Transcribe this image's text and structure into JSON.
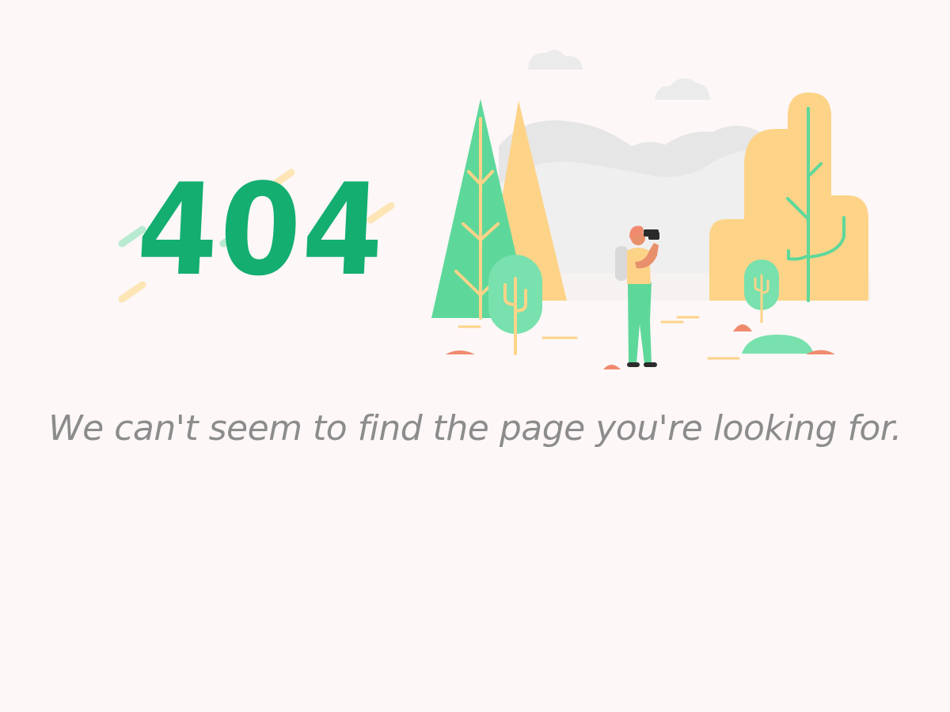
{
  "error": {
    "code": "404",
    "message": "We can't seem to find the page you're looking for."
  },
  "colors": {
    "background": "#fdf7f7",
    "accent_green": "#13ae70",
    "tree_green": "#5ed89a",
    "tree_yellow": "#fdd388",
    "mountain_grey": "#e7e7e7",
    "figure_accent": "#f08a6e",
    "message_text": "#8c8c8c"
  },
  "illustration": {
    "subject": "hiker-with-binoculars-in-forest"
  }
}
